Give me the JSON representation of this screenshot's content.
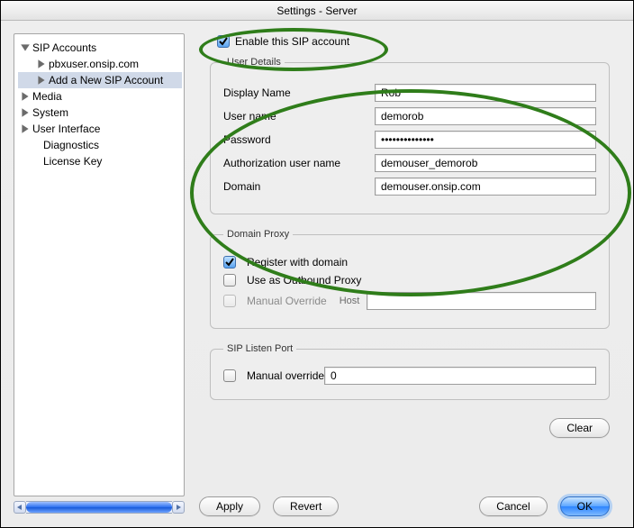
{
  "window": {
    "title": "Settings - Server"
  },
  "sidebar": {
    "items": [
      {
        "label": "SIP Accounts",
        "expanded": true,
        "level": 0
      },
      {
        "label": "pbxuser.onsip.com",
        "level": 1,
        "leaf": true
      },
      {
        "label": "Add a New SIP Account",
        "level": 1,
        "leaf": true,
        "selected": true
      },
      {
        "label": "Media",
        "level": 0,
        "leaf": true
      },
      {
        "label": "System",
        "level": 0,
        "leaf": true
      },
      {
        "label": "User Interface",
        "level": 0,
        "leaf": true
      },
      {
        "label": "Diagnostics",
        "level": 0,
        "leaf": true,
        "noarrow": true
      },
      {
        "label": "License Key",
        "level": 0,
        "leaf": true,
        "noarrow": true
      }
    ]
  },
  "form": {
    "enable_label": "Enable this SIP account",
    "enable_checked": true,
    "user_details": {
      "legend": "User Details",
      "display_name": {
        "label": "Display Name",
        "value": "Rob"
      },
      "user_name": {
        "label": "User name",
        "value": "demorob"
      },
      "password": {
        "label": "Password",
        "value": "••••••••••••••"
      },
      "auth_user": {
        "label": "Authorization user name",
        "value": "demouser_demorob"
      },
      "domain": {
        "label": "Domain",
        "value": "demouser.onsip.com"
      }
    },
    "domain_proxy": {
      "legend": "Domain Proxy",
      "register_label": "Register with domain",
      "register_checked": true,
      "outbound_label": "Use as Outbound Proxy",
      "outbound_checked": false,
      "manual_label": "Manual Override",
      "manual_checked": false,
      "host_label": "Host",
      "host_value": ""
    },
    "listen_port": {
      "legend": "SIP Listen Port",
      "manual_label": "Manual override",
      "manual_checked": false,
      "value": "0"
    }
  },
  "buttons": {
    "clear": "Clear",
    "apply": "Apply",
    "revert": "Revert",
    "cancel": "Cancel",
    "ok": "OK"
  }
}
